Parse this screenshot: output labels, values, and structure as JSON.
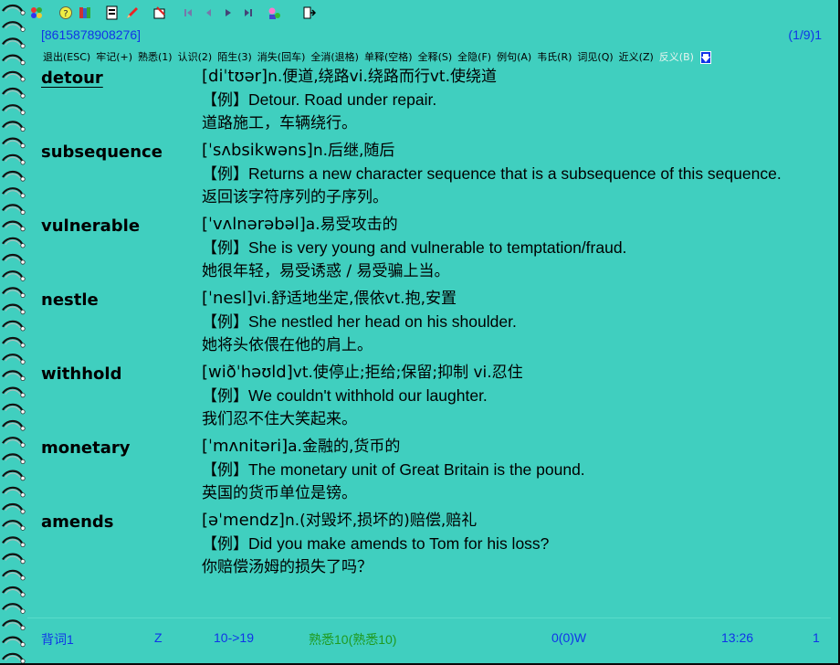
{
  "header": {
    "phone": "[8615878908276]",
    "position": "(1/9)1"
  },
  "toolbar": {
    "icons": [
      "colors-icon",
      "help-icon",
      "books-icon",
      "page-icon",
      "pencil-icon",
      "mark-icon",
      "first-icon",
      "prev-icon",
      "play-icon",
      "next-icon",
      "user-icon",
      "exit-icon"
    ]
  },
  "menu": {
    "items": [
      "退出(ESC)",
      "牢记(+)",
      "熟悉(1)",
      "认识(2)",
      "陌生(3)",
      "消失(回车)",
      "全消(退格)",
      "单释(空格)",
      "全释(S)",
      "全隐(F)",
      "例句(A)",
      "韦氏(R)",
      "词见(Q)",
      "近义(Z)",
      "反义(B)"
    ]
  },
  "entries": [
    {
      "word": "detour",
      "phonetic": "[diˈtʊər]",
      "meaning": "n.便道,绕路vi.绕路而行vt.使绕道",
      "example_prefix": "【例】",
      "example": "Detour. Road under repair.",
      "translation": "道路施工，车辆绕行。"
    },
    {
      "word": "subsequence",
      "phonetic": "[ˈsʌbsikwəns]",
      "meaning": "n.后继,随后",
      "example_prefix": "【例】",
      "example": "Returns a new character sequence that is a subsequence of this sequence.",
      "translation": "返回该字符序列的子序列。"
    },
    {
      "word": "vulnerable",
      "phonetic": "[ˈvʌlnərəbəl]",
      "meaning": "a.易受攻击的",
      "example_prefix": "【例】",
      "example": "She is very young and vulnerable to temptation/fraud.",
      "translation": "她很年轻，易受诱惑 / 易受骗上当。"
    },
    {
      "word": "nestle",
      "phonetic": "[ˈnesl]",
      "meaning": "vi.舒适地坐定,偎依vt.抱,安置",
      "example_prefix": "【例】",
      "example": "She nestled her head on his shoulder.",
      "translation": "她将头依偎在他的肩上。"
    },
    {
      "word": "withhold",
      "phonetic": "[wiðˈhəʊld]",
      "meaning": "vt.使停止;拒给;保留;抑制 vi.忍住",
      "example_prefix": "【例】",
      "example": "We couldn't withhold our laughter.",
      "translation": "我们忍不住大笑起来。"
    },
    {
      "word": "monetary",
      "phonetic": "[ˈmʌnitəri]",
      "meaning": "a.金融的,货币的",
      "example_prefix": "【例】",
      "example": "The monetary unit of Great Britain is the pound.",
      "translation": "英国的货币单位是镑。"
    },
    {
      "word": "amends",
      "phonetic": "[əˈmendz]",
      "meaning": "n.(对毁坏,损坏的)赔偿,赔礼",
      "example_prefix": "【例】",
      "example": "Did you make amends to Tom for his loss?",
      "translation": "你赔偿汤姆的损失了吗？"
    }
  ],
  "status": {
    "mode": "背词1",
    "sort": "Z",
    "range": "10->19",
    "familiar": "熟悉10(熟悉10)",
    "count": "0(0)W",
    "time": "13:26",
    "page": "1"
  },
  "colors": {
    "background": "#40cfbf",
    "blue": "#1034e8",
    "green": "#1f9a1f"
  }
}
